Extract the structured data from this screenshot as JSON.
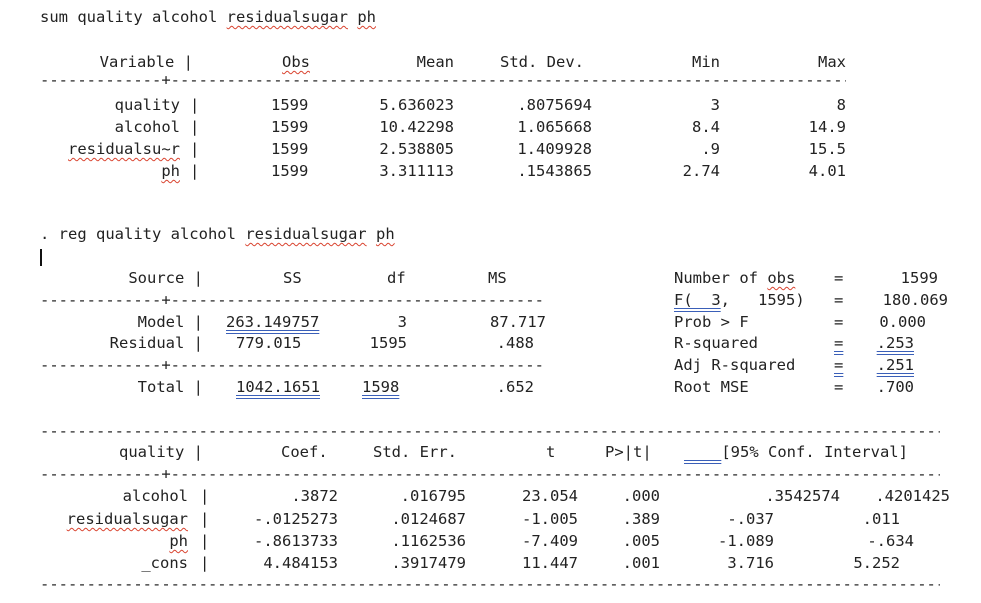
{
  "sum_cmd": {
    "cmd": "sum quality alcohol ",
    "var": "residualsugar",
    "rest": " ",
    "var2": "ph"
  },
  "sum_header": {
    "variable": "Variable |",
    "obs": "Obs",
    "mean": "Mean",
    "sd": "Std. Dev.",
    "min": "Min",
    "max": "Max"
  },
  "sum_rows": [
    {
      "name": "quality",
      "bar": "|",
      "obs": "1599",
      "mean": "5.636023",
      "sd": ".8075694",
      "min": "3",
      "max": "8"
    },
    {
      "name": "alcohol",
      "bar": "|",
      "obs": "1599",
      "mean": "10.42298",
      "sd": "1.065668",
      "min": "8.4",
      "max": "14.9"
    },
    {
      "name": "residualsu~r",
      "bar": "|",
      "obs": "1599",
      "mean": "2.538805",
      "sd": "1.409928",
      "min": ".9",
      "max": "15.5"
    },
    {
      "name": "ph",
      "bar": "|",
      "obs": "1599",
      "mean": "3.311113",
      "sd": ".1543865",
      "min": "2.74",
      "max": "4.01"
    }
  ],
  "reg_cmd": {
    "cmd": ". reg quality alcohol ",
    "var": "residualsugar",
    "rest": " ",
    "var2": "ph"
  },
  "anova_header": {
    "source": "Source |",
    "ss": "SS",
    "df": "df",
    "ms": "MS"
  },
  "anova_rows": [
    {
      "source": "Model |",
      "ss": "263.149757",
      "df": "3",
      "ms": "87.717"
    },
    {
      "source": "Residual |",
      "ss": "779.015",
      "df": "1595",
      "ms": ".488"
    },
    {
      "source": "Total |",
      "ss": "1042.1651",
      "df": "1598",
      "ms": ".652"
    }
  ],
  "stats": [
    {
      "label": "Number of obs",
      "eq": "=",
      "value": "1599"
    },
    {
      "label": "F(  3,   1595)",
      "eq": "=",
      "value": "180.069"
    },
    {
      "label": "Prob > F",
      "eq": "=",
      "value": "0.000"
    },
    {
      "label": "R-squared",
      "eq": "=",
      "value": ".253"
    },
    {
      "label": "Adj R-squared",
      "eq": "=",
      "value": ".251"
    },
    {
      "label": "Root MSE",
      "eq": "=",
      "value": ".700"
    }
  ],
  "coef_header": {
    "dep": "quality |",
    "coef": "Coef.",
    "se": "Std. Err.",
    "t": "t",
    "p": "P>|t|",
    "ci": "[95% Conf. Interval]"
  },
  "coef_rows": [
    {
      "name": "alcohol",
      "bar": "|",
      "coef": ".3872",
      "se": ".016795",
      "t": "23.054",
      "p": ".000",
      "lo": ".3542574",
      "hi": ".4201425"
    },
    {
      "name": "residualsugar",
      "bar": "|",
      "coef": "-.0125273",
      "se": ".0124687",
      "t": "-1.005",
      "p": ".389",
      "lo": "-.037",
      "hi": ".011"
    },
    {
      "name": "ph",
      "bar": "|",
      "coef": "-.8613733",
      "se": ".1162536",
      "t": "-7.409",
      "p": ".005",
      "lo": "-1.089",
      "hi": "-.634"
    },
    {
      "name": "_cons",
      "bar": "|",
      "coef": "4.484153",
      "se": ".3917479",
      "t": "11.447",
      "p": ".001",
      "lo": "3.716",
      "hi": "5.252"
    }
  ]
}
